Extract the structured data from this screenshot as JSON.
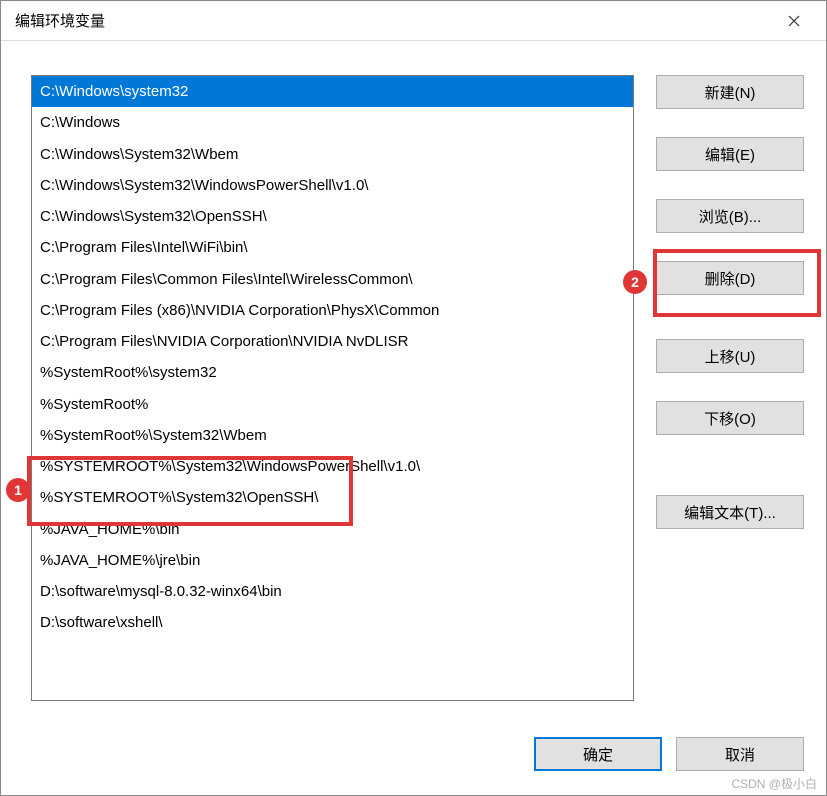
{
  "window": {
    "title": "编辑环境变量"
  },
  "list": {
    "items": [
      {
        "text": "C:\\Windows\\system32",
        "selected": true
      },
      {
        "text": "C:\\Windows",
        "selected": false
      },
      {
        "text": "C:\\Windows\\System32\\Wbem",
        "selected": false
      },
      {
        "text": "C:\\Windows\\System32\\WindowsPowerShell\\v1.0\\",
        "selected": false
      },
      {
        "text": "C:\\Windows\\System32\\OpenSSH\\",
        "selected": false
      },
      {
        "text": "C:\\Program Files\\Intel\\WiFi\\bin\\",
        "selected": false
      },
      {
        "text": "C:\\Program Files\\Common Files\\Intel\\WirelessCommon\\",
        "selected": false
      },
      {
        "text": "C:\\Program Files (x86)\\NVIDIA Corporation\\PhysX\\Common",
        "selected": false
      },
      {
        "text": "C:\\Program Files\\NVIDIA Corporation\\NVIDIA NvDLISR",
        "selected": false
      },
      {
        "text": "%SystemRoot%\\system32",
        "selected": false
      },
      {
        "text": "%SystemRoot%",
        "selected": false
      },
      {
        "text": "%SystemRoot%\\System32\\Wbem",
        "selected": false
      },
      {
        "text": "%SYSTEMROOT%\\System32\\WindowsPowerShell\\v1.0\\",
        "selected": false
      },
      {
        "text": "%SYSTEMROOT%\\System32\\OpenSSH\\",
        "selected": false
      },
      {
        "text": "%JAVA_HOME%\\bin",
        "selected": false
      },
      {
        "text": "%JAVA_HOME%\\jre\\bin",
        "selected": false
      },
      {
        "text": "D:\\software\\mysql-8.0.32-winx64\\bin",
        "selected": false
      },
      {
        "text": "D:\\software\\xshell\\",
        "selected": false
      }
    ]
  },
  "buttons": {
    "new": "新建(N)",
    "edit": "编辑(E)",
    "browse": "浏览(B)...",
    "delete": "删除(D)",
    "move_up": "上移(U)",
    "move_down": "下移(O)",
    "edit_text": "编辑文本(T)...",
    "ok": "确定",
    "cancel": "取消"
  },
  "annotations": {
    "badge1": "1",
    "badge2": "2"
  },
  "watermark": "CSDN @极小白"
}
